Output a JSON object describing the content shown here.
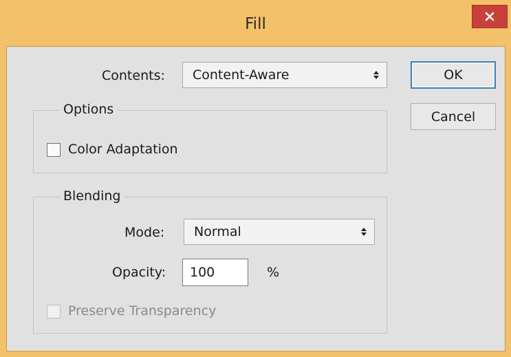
{
  "window": {
    "title": "Fill",
    "accent_color": "#f3c16a",
    "close_color": "#c8403a"
  },
  "contents": {
    "label": "Contents:",
    "value": "Content-Aware"
  },
  "buttons": {
    "ok": "OK",
    "cancel": "Cancel"
  },
  "options": {
    "legend": "Options",
    "color_adaptation_label": "Color Adaptation",
    "color_adaptation_checked": false
  },
  "blending": {
    "legend": "Blending",
    "mode_label": "Mode:",
    "mode_value": "Normal",
    "opacity_label": "Opacity:",
    "opacity_value": "100",
    "opacity_unit": "%",
    "preserve_transparency_label": "Preserve Transparency",
    "preserve_transparency_checked": false,
    "preserve_transparency_enabled": false
  },
  "icons": {
    "close": "close-icon",
    "dropdown": "dropdown-arrows-icon"
  }
}
